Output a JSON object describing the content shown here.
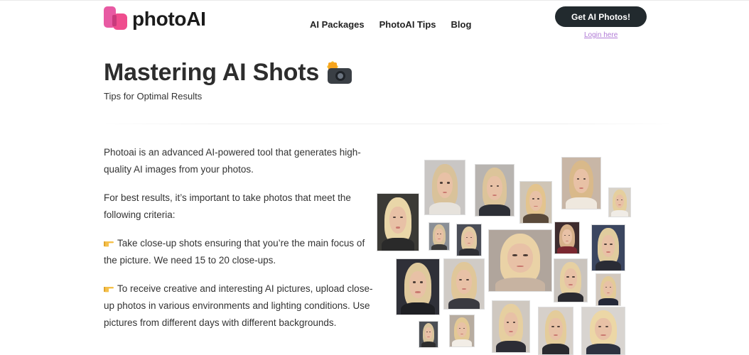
{
  "header": {
    "logo_text": "photoAI",
    "nav": [
      "AI Packages",
      "PhotoAI Tips",
      "Blog"
    ],
    "cta_label": "Get AI Photos!",
    "login_label": "Login here"
  },
  "hero": {
    "title": "Mastering AI Shots",
    "title_icon": "camera-with-flash-icon",
    "subtitle": "Tips for Optimal Results"
  },
  "content": {
    "paragraphs": [
      "Photoai is an advanced AI-powered tool that generates high-quality AI images from your photos.",
      "For best results, it’s important to take photos that meet the following criteria:",
      "Take close-up shots ensuring that you’re the main focus of the picture. We need 15 to 20 close-ups.",
      "To receive creative and interesting AI pictures, upload close-up photos in various environments and lighting conditions. Use pictures from different days with different backgrounds."
    ],
    "bullet_icon": "pointing-hand-icon"
  },
  "colors": {
    "brand_pink": "#ef4d8e",
    "cta_bg": "#222a2e",
    "login_link": "#b07ad6"
  }
}
